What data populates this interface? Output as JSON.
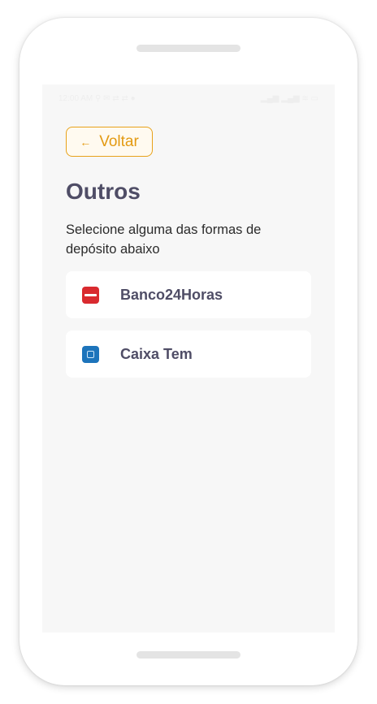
{
  "statusbar": {
    "left": "12:00 AM ⚲ ✉ ⇄ ⇄ ●",
    "right": "▂▄▆ ▂▄▆ ≋ ▭"
  },
  "header": {
    "back_label": "Voltar",
    "back_icon": "arrow-left-icon",
    "title": "Outros",
    "subtitle": "Selecione alguma das formas de depósito abaixo"
  },
  "options": [
    {
      "label": "Banco24Horas",
      "icon": "banco24horas-logo",
      "color": "#d92a2f"
    },
    {
      "label": "Caixa Tem",
      "icon": "caixa-tem-logo",
      "color": "#1d74bb"
    }
  ],
  "colors": {
    "accent": "#e39a12",
    "title": "#4f4d66",
    "background": "#f7f7f7"
  }
}
